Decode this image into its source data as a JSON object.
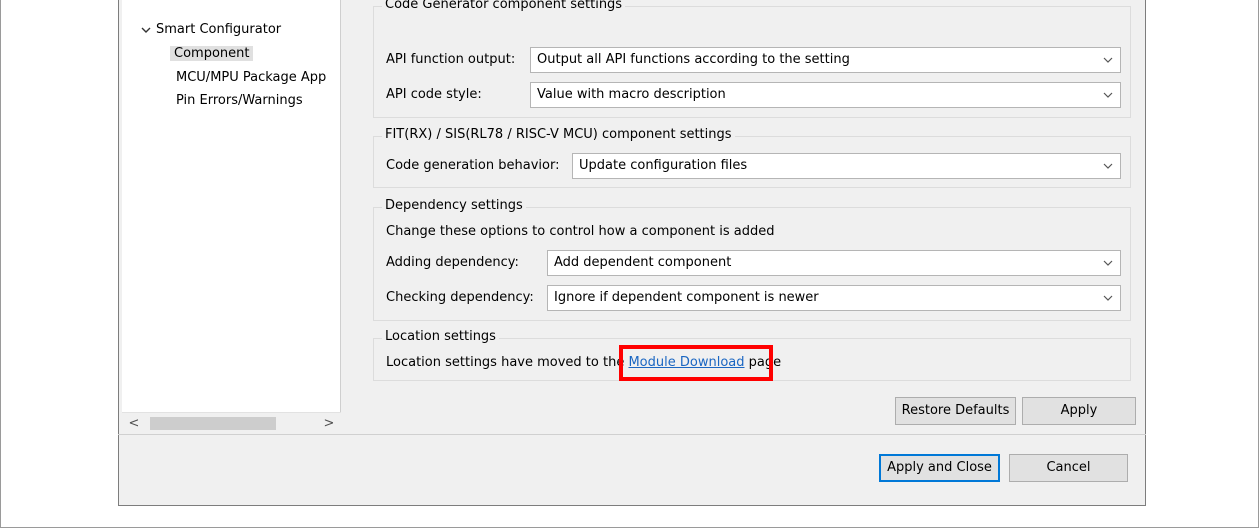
{
  "tree": {
    "root_label": "Smart Configurator",
    "items": [
      {
        "label": "Component"
      },
      {
        "label": "MCU/MPU Package App"
      },
      {
        "label": "Pin Errors/Warnings"
      }
    ],
    "scroll_left": "<",
    "scroll_right": ">"
  },
  "code_generator": {
    "title": "Code Generator component settings",
    "api_output_label": "API function output:",
    "api_output_value": "Output all API functions according to the setting",
    "api_style_label": "API code style:",
    "api_style_value": "Value with macro description"
  },
  "fit": {
    "title": "FIT(RX) / SIS(RL78 / RISC-V MCU) component settings",
    "behavior_label": "Code generation behavior:",
    "behavior_value": "Update configuration files"
  },
  "dependency": {
    "title": "Dependency settings",
    "description": "Change these options to control how a component is added",
    "adding_label": "Adding dependency:",
    "adding_value": "Add dependent component",
    "checking_label": "Checking dependency:",
    "checking_value": "Ignore if dependent component is newer"
  },
  "location": {
    "title": "Location settings",
    "text_before": "Location settings have moved to the ",
    "link": "Module Download",
    "text_after": " page"
  },
  "buttons": {
    "restore_defaults": "Restore Defaults",
    "apply": "Apply",
    "apply_and_close": "Apply and Close",
    "cancel": "Cancel"
  },
  "colors": {
    "highlight": "#ff0000",
    "link": "#1a66c2",
    "default_button_border": "#0078d7"
  }
}
